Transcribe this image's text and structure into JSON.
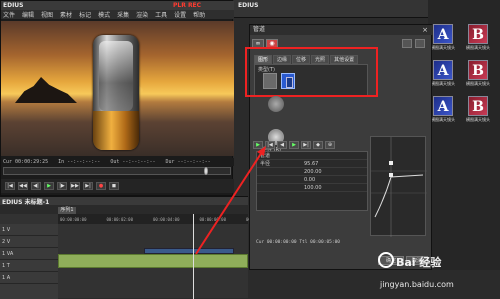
{
  "player": {
    "title": "EDIUS",
    "plr_label": "PLR",
    "rec_label": "REC",
    "menu": [
      "文件",
      "编辑",
      "视图",
      "素材",
      "标记",
      "模式",
      "采集",
      "渲染",
      "工具",
      "设置",
      "帮助"
    ],
    "timecodes": {
      "cur": "Cur 00:00:29:25",
      "in": "In --:--:--:--",
      "out": "Out --:--:--:--",
      "dur": "Dur --:--:--:--"
    }
  },
  "transport": [
    "|◀",
    "◀◀",
    "◀|",
    "▶",
    "|▶",
    "▶▶",
    "▶|",
    "●",
    "◼"
  ],
  "timeline": {
    "title": "EDIUS 未标题-1",
    "tab_label": "序列1",
    "ruler": [
      "00:00:00:00",
      "00:00:02:00",
      "00:00:04:00",
      "00:00:06:00",
      "00:00:08:00"
    ],
    "tracks": [
      "1 V",
      "2 V",
      "1 VA",
      "1 T",
      "1 A"
    ]
  },
  "bin": {
    "title": "EDIUS",
    "tiles": [
      {
        "letter": "A",
        "caption": "横图满天镜头",
        "color": "blue"
      },
      {
        "letter": "B",
        "caption": "横图满天镜头",
        "color": "red"
      },
      {
        "letter": "A",
        "caption": "横图满天镜头",
        "color": "blue"
      },
      {
        "letter": "B",
        "caption": "横图满天镜头",
        "color": "red"
      },
      {
        "letter": "A",
        "caption": "横图满天镜头",
        "color": "blue"
      },
      {
        "letter": "B",
        "caption": "横图满天镜头",
        "color": "red"
      }
    ]
  },
  "dialog": {
    "title": "管道",
    "close": "×",
    "tabs": [
      "图形",
      "边缘",
      "位移",
      "光照",
      "其他设置"
    ],
    "group_label": "类型(T)",
    "knob_label": "半径 (R)",
    "keyframes": [
      {
        "name": "管道",
        "val": ""
      },
      {
        "name": "半径",
        "val": "95.67"
      },
      {
        "name": "",
        "val": "200.00"
      },
      {
        "name": "",
        "val": "0.00"
      },
      {
        "name": "",
        "val": "100.00"
      }
    ],
    "footer": "Cur 00:00:00:00   Ttl 00:00:05:00",
    "ok": "确定",
    "cancel": "取消"
  },
  "watermark": {
    "brand": "Bai 经验",
    "url": "jingyan.baidu.com"
  }
}
